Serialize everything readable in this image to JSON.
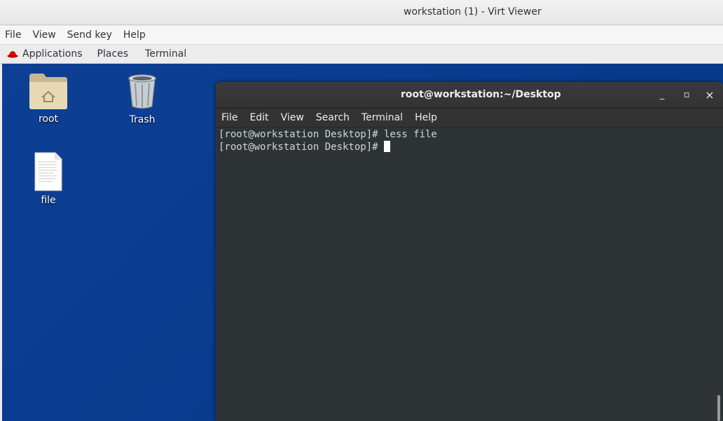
{
  "window": {
    "title": "workstation (1) - Virt Viewer"
  },
  "viewer_menu": [
    "File",
    "View",
    "Send key",
    "Help"
  ],
  "panel": {
    "applications": "Applications",
    "places": "Places",
    "terminal": "Terminal"
  },
  "desktop_icons": [
    {
      "label": "root",
      "icon": "home-folder-icon"
    },
    {
      "label": "Trash",
      "icon": "trash-icon"
    },
    {
      "label": "file",
      "icon": "text-file-icon"
    }
  ],
  "terminal": {
    "title": "root@workstation:~/Desktop",
    "menu": [
      "File",
      "Edit",
      "View",
      "Search",
      "Terminal",
      "Help"
    ],
    "lines": [
      "[root@workstation Desktop]# less file",
      "[root@workstation Desktop]# "
    ],
    "buttons": {
      "minimize": "_",
      "maximize": "▫",
      "close": "×"
    }
  },
  "colors": {
    "desktop": "#0a3d91",
    "terminal_bg": "#2e3436",
    "terminal_text": "#d3d7cf"
  }
}
